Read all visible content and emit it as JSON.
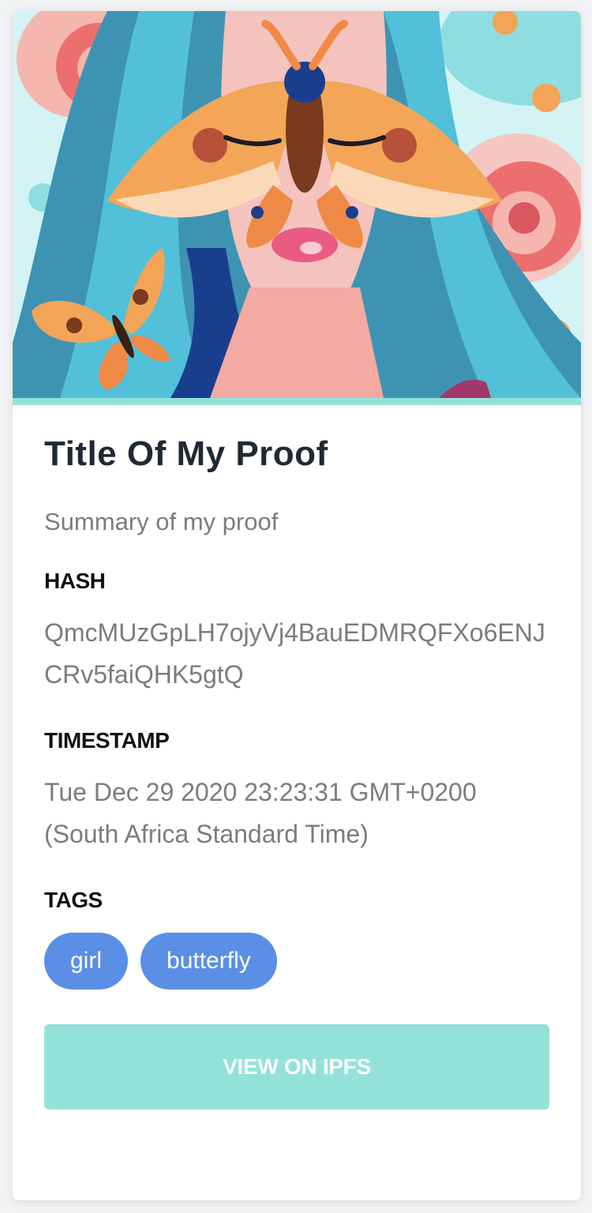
{
  "proof": {
    "image_alt": "Illustration of a woman with a moth over her eyes and a butterfly",
    "title": "Title Of My Proof",
    "summary": "Summary of my proof",
    "hash_label": "HASH",
    "hash_value": "QmcMUzGpLH7ojyVj4BauEDMRQFXo6ENJCRv5faiQHK5gtQ",
    "timestamp_label": "TIMESTAMP",
    "timestamp_value": "Tue Dec 29 2020 23:23:31 GMT+0200 (South Africa Standard Time)",
    "tags_label": "TAGS",
    "tags": [
      "girl",
      "butterfly"
    ],
    "button_label": "VIEW ON IPFS"
  },
  "colors": {
    "accent": "#93e2d9",
    "tag": "#5b8fe6",
    "title": "#1f2933",
    "muted": "#7c7c7c"
  }
}
